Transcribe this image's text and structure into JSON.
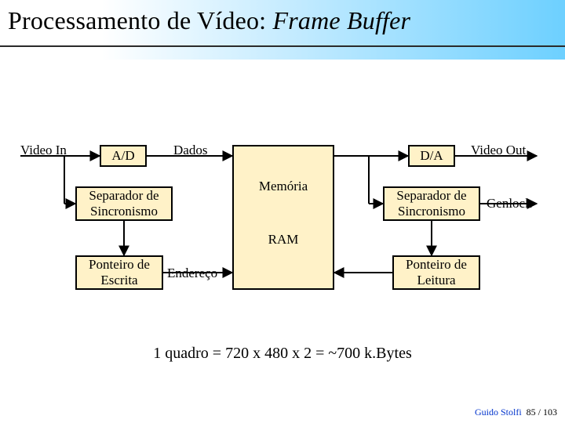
{
  "title": {
    "plain": "Processamento de Vídeo: ",
    "italic": "Frame Buffer"
  },
  "labels": {
    "video_in": "Video In",
    "dados": "Dados",
    "video_out": "Video Out",
    "genlock": "Genlock",
    "endereco": "Endereço"
  },
  "boxes": {
    "ad": "A/D",
    "da": "D/A",
    "sep_sinc_left": "Separador de Sincronismo",
    "sep_sinc_right": "Separador de Sincronismo",
    "ponteiro_escrita": "Ponteiro de Escrita",
    "ponteiro_leitura": "Ponteiro de Leitura",
    "memoria": "Memória",
    "ram": "RAM"
  },
  "caption": "1 quadro = 720 x 480 x 2 = ~700 k.Bytes",
  "footer": {
    "author": "Guido Stolfi",
    "page": "85 / 103"
  }
}
